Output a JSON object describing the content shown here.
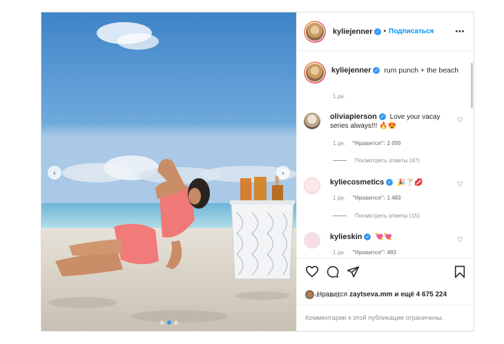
{
  "post": {
    "author": "kyliejenner",
    "follow_sep": "•",
    "follow_label": "Подписаться",
    "more_icon": "⋯",
    "caption": "rum punch + the beach",
    "caption_time": "1 дн."
  },
  "comments": [
    {
      "user": "oliviapierson",
      "text": "Love your vacay series always!!! 🔥😍",
      "time": "1 дн.",
      "likes": "\"Нравится\": 2 050",
      "replies": "Посмотреть ответы (47)"
    },
    {
      "user": "kyliecosmetics",
      "text": "🎉🍸💋",
      "time": "1 дн.",
      "likes": "\"Нравится\": 1 483",
      "replies": "Посмотреть ответы (15)"
    },
    {
      "user": "kylieskin",
      "text": "💘💘",
      "time": "1 дн.",
      "likes": "\"Нравится\": 493"
    }
  ],
  "likes_line": {
    "prefix": "Нравится",
    "user": "zaytseva.mm",
    "suffix": "и ещё 4 675 224"
  },
  "posted_ago": "ДЕНЬ НАЗАД",
  "comments_disabled": "Комментарии к этой публикации ограничены.",
  "colors": {
    "accent": "#0095f6",
    "verified": "#3897f0",
    "muted": "#8e8e8e"
  },
  "icons": [
    "heart-icon",
    "comment-icon",
    "share-icon",
    "bookmark-icon",
    "verified-icon",
    "more-icon"
  ]
}
